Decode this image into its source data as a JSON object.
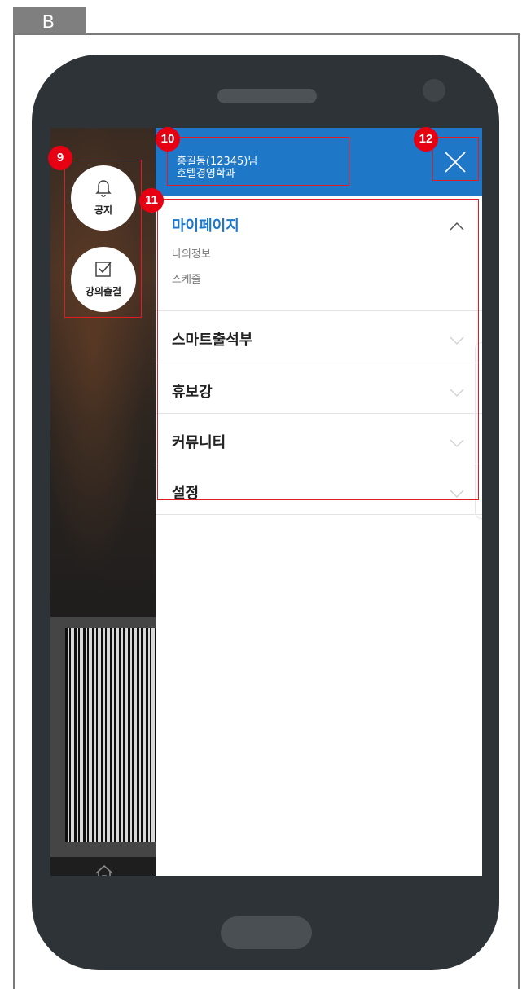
{
  "section_label": "B",
  "header": {
    "user_name": "홍길동(12345)님",
    "department": "호텔경영학과"
  },
  "quick_buttons": [
    {
      "label": "공지",
      "icon": "bell-icon"
    },
    {
      "label": "강의출결",
      "icon": "checkbox-icon"
    }
  ],
  "menu": {
    "items": [
      {
        "label": "마이페이지",
        "expanded": true,
        "subitems": [
          "나의정보",
          "스케줄"
        ]
      },
      {
        "label": "스마트출석부",
        "expanded": false
      },
      {
        "label": "휴보강",
        "expanded": false
      },
      {
        "label": "커뮤니티",
        "expanded": false
      },
      {
        "label": "설정",
        "expanded": false
      }
    ]
  },
  "annotations": [
    "9",
    "10",
    "11",
    "12"
  ],
  "colors": {
    "accent": "#1e77c7",
    "annotation": "#e60012",
    "phone_body": "#2e3338"
  },
  "icons": [
    "bell-icon",
    "checkbox-icon",
    "home-icon",
    "close-icon",
    "chevron-up-icon",
    "chevron-down-icon"
  ]
}
